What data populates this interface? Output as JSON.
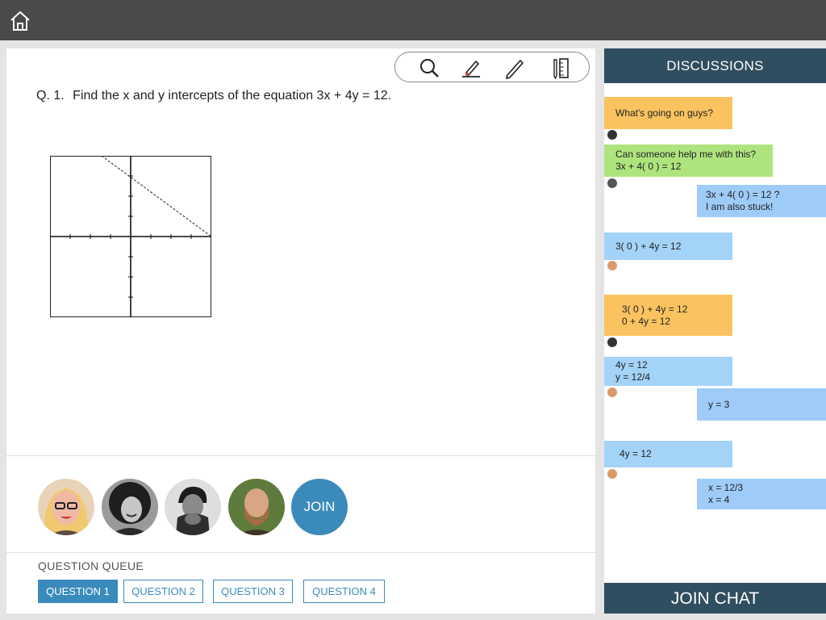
{
  "header": {
    "home_icon": "home-icon"
  },
  "toolbar": {
    "tools": [
      "search-icon",
      "highlighter-icon",
      "pen-icon",
      "ruler-icon"
    ]
  },
  "question": {
    "number": "Q. 1.",
    "text": "Find the x and y intercepts of the equation 3x + 4y = 12."
  },
  "participants": [
    "avatar-1",
    "avatar-2",
    "avatar-3",
    "avatar-4"
  ],
  "join_label": "JOIN",
  "queue": {
    "label": "QUESTION QUEUE",
    "items": [
      "QUESTION 1",
      "QUESTION 2",
      "QUESTION 3",
      "QUESTION 4"
    ],
    "active": 0
  },
  "discussions": {
    "title": "DISCUSSIONS",
    "messages": [
      {
        "lines": [
          "What's going on guys?"
        ]
      },
      {
        "lines": [
          "Can someone help me with this?",
          "3x + 4( 0 ) = 12"
        ]
      },
      {
        "lines": [
          "3x + 4( 0 ) = 12 ?",
          "I am also stuck!"
        ]
      },
      {
        "lines": [
          "3( 0 ) + 4y = 12"
        ]
      },
      {
        "lines": [
          "3( 0 ) + 4y = 12",
          "0 + 4y = 12"
        ]
      },
      {
        "lines": [
          "4y = 12",
          "y = 12/4"
        ]
      },
      {
        "lines": [
          "y = 3"
        ]
      },
      {
        "lines": [
          "4y = 12"
        ]
      },
      {
        "lines": [
          "x = 12/3",
          "x = 4"
        ]
      }
    ],
    "join_chat_label": "JOIN CHAT"
  },
  "colors": {
    "topbar": "#4a4a4a",
    "accent": "#3a8bbb",
    "sidebar_header": "#2f4e5f",
    "bubble_orange": "#fbc35f",
    "bubble_green": "#aee47e",
    "bubble_blue": "#9fcbf9"
  }
}
